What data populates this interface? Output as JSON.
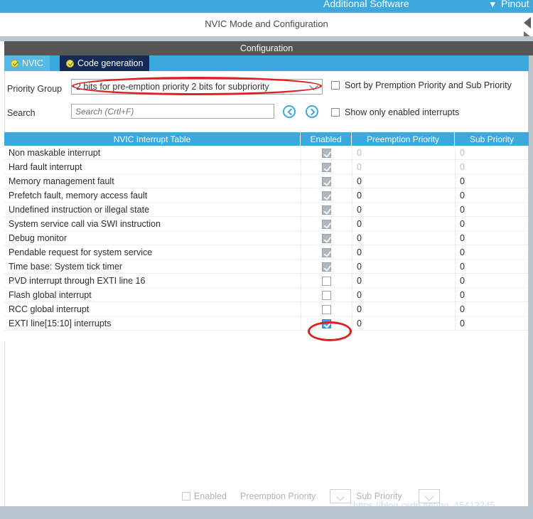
{
  "ribbon": {
    "additional_software": "Additional Software",
    "pinout": "Pinout",
    "chevron": "⌄"
  },
  "title_strip": {
    "text": "NVIC Mode and Configuration"
  },
  "config_header": {
    "text": "Configuration"
  },
  "tabs": [
    {
      "label": "NVIC",
      "active": true
    },
    {
      "label": "Code generation",
      "active": false
    }
  ],
  "form": {
    "priority_group_label": "Priority Group",
    "priority_group_value": "2 bits for pre-emption priority 2 bits for subpriority",
    "search_label": "Search",
    "search_value": "",
    "search_placeholder": "Search (Crtl+F)",
    "sort_checkbox_label": "Sort by Premption Priority and Sub Priority",
    "sort_checkbox_checked": false,
    "show_enabled_checkbox_label": "Show only enabled interrupts",
    "show_enabled_checkbox_checked": false,
    "nav_prev_icon": "chevron-left-icon",
    "nav_next_icon": "chevron-right-icon"
  },
  "table": {
    "headers": {
      "name": "NVIC Interrupt Table",
      "enabled": "Enabled",
      "preemption": "Preemption Priority",
      "sub": "Sub Priority"
    },
    "rows": [
      {
        "name": "Non maskable interrupt",
        "enabled": "locked",
        "preemption": "0",
        "sub": "0",
        "dim": true
      },
      {
        "name": "Hard fault interrupt",
        "enabled": "locked",
        "preemption": "0",
        "sub": "0",
        "dim": true
      },
      {
        "name": "Memory management fault",
        "enabled": "locked",
        "preemption": "0",
        "sub": "0",
        "dim": false
      },
      {
        "name": "Prefetch fault, memory access fault",
        "enabled": "locked",
        "preemption": "0",
        "sub": "0",
        "dim": false
      },
      {
        "name": "Undefined instruction or illegal state",
        "enabled": "locked",
        "preemption": "0",
        "sub": "0",
        "dim": false
      },
      {
        "name": "System service call via SWI instruction",
        "enabled": "locked",
        "preemption": "0",
        "sub": "0",
        "dim": false
      },
      {
        "name": "Debug monitor",
        "enabled": "locked",
        "preemption": "0",
        "sub": "0",
        "dim": false
      },
      {
        "name": "Pendable request for system service",
        "enabled": "locked",
        "preemption": "0",
        "sub": "0",
        "dim": false
      },
      {
        "name": "Time base: System tick timer",
        "enabled": "locked",
        "preemption": "0",
        "sub": "0",
        "dim": false
      },
      {
        "name": "PVD interrupt through EXTI line 16",
        "enabled": "unchecked",
        "preemption": "0",
        "sub": "0",
        "dim": false
      },
      {
        "name": "Flash global interrupt",
        "enabled": "unchecked",
        "preemption": "0",
        "sub": "0",
        "dim": false
      },
      {
        "name": "RCC global interrupt",
        "enabled": "unchecked",
        "preemption": "0",
        "sub": "0",
        "dim": false
      },
      {
        "name": "EXTI line[15:10] interrupts",
        "enabled": "active",
        "preemption": "0",
        "sub": "0",
        "dim": false
      }
    ]
  },
  "bottom_bar": {
    "enabled_label": "Enabled",
    "enabled_checked": false,
    "preemption_label": "Preemption Priority",
    "preemption_value": "",
    "sub_label": "Sub Priority",
    "sub_value": ""
  },
  "watermark": {
    "text": "https://blog.csdn.net/qq_45413245"
  },
  "colors": {
    "accent": "#3ba9dd",
    "tab_active": "#56b9e4",
    "tab_inactive": "#142b57",
    "header_gray": "#555555",
    "band": "#b9c6cf",
    "annotation": "#e02020"
  }
}
